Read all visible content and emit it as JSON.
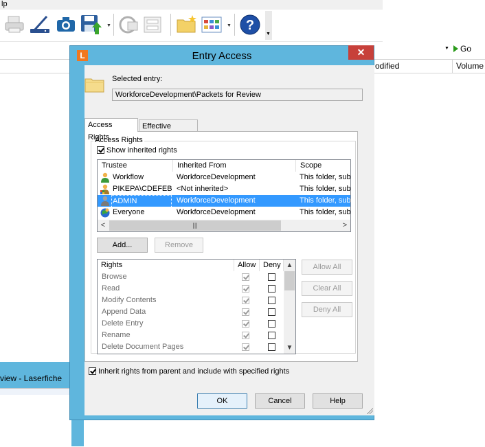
{
  "background_app": {
    "menu_fragment": "lp",
    "go_label": "Go",
    "columns": [
      "odified",
      "Volume"
    ],
    "window_title": "view - Laserfiche"
  },
  "dialog": {
    "app_icon_letter": "L",
    "title": "Entry Access",
    "close_glyph": "✕",
    "selected_entry_label": "Selected entry:",
    "selected_entry_value": "WorkforceDevelopment\\Packets for Review",
    "tabs": [
      {
        "label": "Access Rights",
        "active": true
      },
      {
        "label": "Effective Rights",
        "active": false
      }
    ],
    "group_label": "Access Rights",
    "show_inherited": {
      "label": "Show inherited rights",
      "checked": true
    },
    "trustee_list": {
      "columns": [
        "Trustee",
        "Inherited From",
        "Scope"
      ],
      "rows": [
        {
          "trustee": "Workflow",
          "inherited_from": "WorkforceDevelopment",
          "scope": "This folder, sub",
          "icon": "user-icon",
          "selected": false
        },
        {
          "trustee": "PIKEPA\\CDEFEBO",
          "inherited_from": "<Not inherited>",
          "scope": "This folder, sub",
          "icon": "windows-user-icon",
          "selected": false
        },
        {
          "trustee": "ADMIN",
          "inherited_from": "WorkforceDevelopment",
          "scope": "This folder, sub",
          "icon": "user-icon",
          "selected": true
        },
        {
          "trustee": "Everyone",
          "inherited_from": "WorkforceDevelopment",
          "scope": "This folder, sub",
          "icon": "group-icon",
          "selected": false
        }
      ]
    },
    "add_button": "Add...",
    "remove_button": "Remove",
    "rights_list": {
      "columns": [
        "Rights",
        "Allow",
        "Deny"
      ],
      "rows": [
        {
          "name": "Browse",
          "allow": true,
          "deny": false
        },
        {
          "name": "Read",
          "allow": true,
          "deny": false
        },
        {
          "name": "Modify Contents",
          "allow": true,
          "deny": false
        },
        {
          "name": "Append Data",
          "allow": true,
          "deny": false
        },
        {
          "name": "Delete Entry",
          "allow": true,
          "deny": false
        },
        {
          "name": "Rename",
          "allow": true,
          "deny": false
        },
        {
          "name": "Delete Document Pages",
          "allow": true,
          "deny": false
        }
      ]
    },
    "allow_all_button": "Allow All",
    "clear_all_button": "Clear All",
    "deny_all_button": "Deny All",
    "inherit_rights": {
      "label": "Inherit rights from parent and include with specified rights",
      "checked": true
    },
    "ok_button": "OK",
    "cancel_button": "Cancel",
    "help_button": "Help"
  },
  "colors": {
    "title_bar": "#5fb6dd",
    "close_button": "#c7403a",
    "selection": "#3399ff",
    "app_icon": "#f07820"
  }
}
